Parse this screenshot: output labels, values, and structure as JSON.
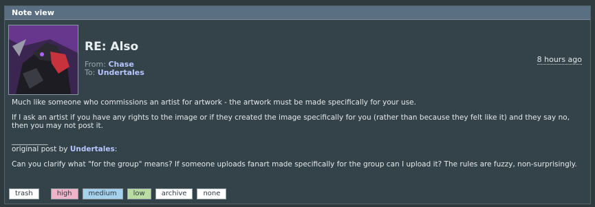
{
  "header": {
    "title": "Note view"
  },
  "note": {
    "subject": "RE: Also",
    "from_label": "From:",
    "from_user": "Chase",
    "to_label": "To:",
    "to_user": "Undertales",
    "timestamp": "8 hours ago",
    "paragraph1": "Much like someone who commissions an artist for artwork - the artwork must be made specifically for your use.",
    "paragraph2": "If I ask an artist if you have any rights to the image or if they created the image specifically for you (rather than because they felt like it) and they say no, then you may not post it.",
    "separator": "__________",
    "quote_prefix": "original post by",
    "quote_user": "Undertales",
    "quote_suffix": ":",
    "quote_text": "Can you clarify what \"for the group\" means? If someone uploads fanart made specifically for the group can I upload it? The rules are fuzzy, non-surprisingly."
  },
  "tags": {
    "trash": "trash",
    "high": "high",
    "medium": "medium",
    "low": "low",
    "archive": "archive",
    "none": "none"
  },
  "colors": {
    "background": "#2f3a3f",
    "header_bar": "#5b6f83",
    "link": "#b6c6ff",
    "high": "#f0b4c8",
    "medium": "#a6d2ee",
    "low": "#b8dca2"
  }
}
